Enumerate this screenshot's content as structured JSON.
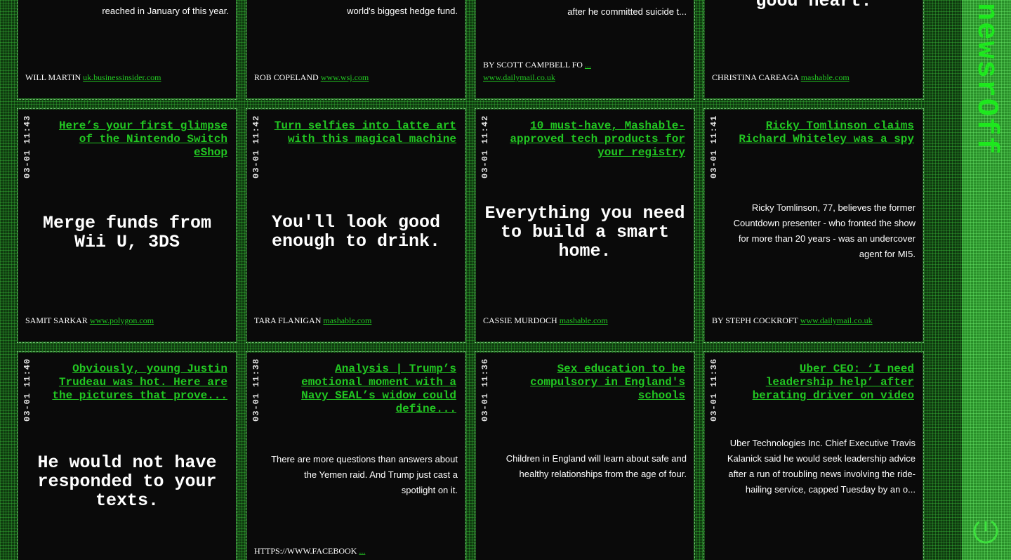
{
  "sidebar": {
    "brand": "newsrOff",
    "power_icon": "power-icon"
  },
  "row0": [
    {
      "desc_end": "reached in January of this year.",
      "author": "WILL MARTIN",
      "source": "uk.businessinsider.com"
    },
    {
      "desc_end": "world's biggest hedge fund.",
      "author": "ROB COPELAND",
      "source": "www.wsj.com"
    },
    {
      "desc_end": "after he committed suicide t...",
      "author": "BY SCOTT CAMPBELL FO",
      "author_more": "...",
      "source": "www.dailymail.co.uk"
    },
    {
      "big_end": "good heart.",
      "author": "CHRISTINA CAREAGA",
      "source": "mashable.com"
    }
  ],
  "row1": [
    {
      "timestamp": "03-01 11:43",
      "title": "Here’s your first glimpse of the Nintendo Switch eShop",
      "big": "Merge funds from Wii U, 3DS",
      "author": "SAMIT SARKAR",
      "source": "www.polygon.com"
    },
    {
      "timestamp": "03-01 11:42",
      "title": "Turn selfies into latte art with this magical machine",
      "big": "You'll look good enough to drink.",
      "author": "TARA FLANIGAN",
      "source": "mashable.com"
    },
    {
      "timestamp": "03-01 11:42",
      "title": "10 must-have, Mashable-approved tech products for your registry",
      "big": "Everything you need to build a smart home.",
      "author": "CASSIE MURDOCH",
      "source": "mashable.com"
    },
    {
      "timestamp": "03-01 11:41",
      "title": "Ricky Tomlinson claims Richard Whiteley was a spy",
      "desc": "Ricky Tomlinson, 77, believes the former Countdown presenter - who fronted the show for more than 20 years - was an undercover agent for MI5.",
      "author": "BY STEPH COCKROFT",
      "source": "www.dailymail.co.uk"
    }
  ],
  "row2": [
    {
      "timestamp": "03-01 11:40",
      "title": "Obviously, young Justin Trudeau was hot. Here are the pictures that prove...",
      "big": "He would not have responded to your texts."
    },
    {
      "timestamp": "03-01 11:38",
      "title": "Analysis | Trump’s emotional moment with a Navy SEAL’s widow could define...",
      "desc": "There are more questions than answers about the Yemen raid. And Trump just cast a spotlight on it.",
      "author": "HTTPS://WWW.FACEBOOK",
      "author_more": "..."
    },
    {
      "timestamp": "03-01 11:36",
      "title": "Sex education to be compulsory in England's schools",
      "desc": "Children in England will learn about safe and healthy relationships from the age of four."
    },
    {
      "timestamp": "03-01 11:36",
      "title": "Uber CEO: ‘I need leadership help’ after berating driver on video",
      "desc": "Uber Technologies Inc. Chief Executive Travis Kalanick said he would seek leadership advice after a run of troubling news involving the ride-hailing service, capped Tuesday by an o..."
    }
  ]
}
